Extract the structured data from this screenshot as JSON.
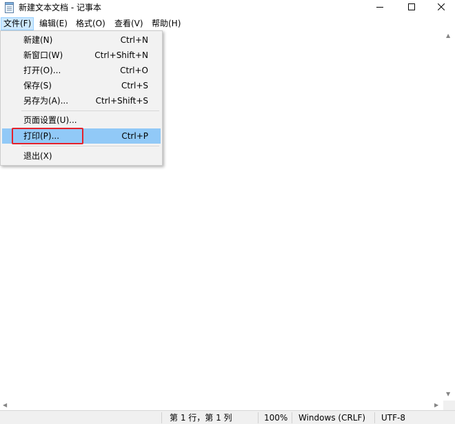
{
  "window": {
    "title": "新建文本文档 - 记事本"
  },
  "menubar": {
    "items": [
      {
        "label": "文件(F)"
      },
      {
        "label": "编辑(E)"
      },
      {
        "label": "格式(O)"
      },
      {
        "label": "查看(V)"
      },
      {
        "label": "帮助(H)"
      }
    ]
  },
  "file_menu": {
    "items": [
      {
        "label": "新建(N)",
        "shortcut": "Ctrl+N"
      },
      {
        "label": "新窗口(W)",
        "shortcut": "Ctrl+Shift+N"
      },
      {
        "label": "打开(O)...",
        "shortcut": "Ctrl+O"
      },
      {
        "label": "保存(S)",
        "shortcut": "Ctrl+S"
      },
      {
        "label": "另存为(A)...",
        "shortcut": "Ctrl+Shift+S"
      },
      {
        "label": "页面设置(U)...",
        "shortcut": ""
      },
      {
        "label": "打印(P)...",
        "shortcut": "Ctrl+P"
      },
      {
        "label": "退出(X)",
        "shortcut": ""
      }
    ],
    "highlighted": "打印(P)..."
  },
  "statusbar": {
    "position": "第 1 行，第 1 列",
    "zoom": "100%",
    "line_ending": "Windows (CRLF)",
    "encoding": "UTF-8"
  },
  "colors": {
    "menu_highlight": "#91c9f7",
    "menubar_active": "#cce8ff",
    "annotation": "#e5212b"
  },
  "icons": [
    "notepad-icon",
    "minimize-icon",
    "maximize-icon",
    "close-icon",
    "scroll-up-icon",
    "scroll-down-icon",
    "scroll-left-icon",
    "scroll-right-icon"
  ]
}
